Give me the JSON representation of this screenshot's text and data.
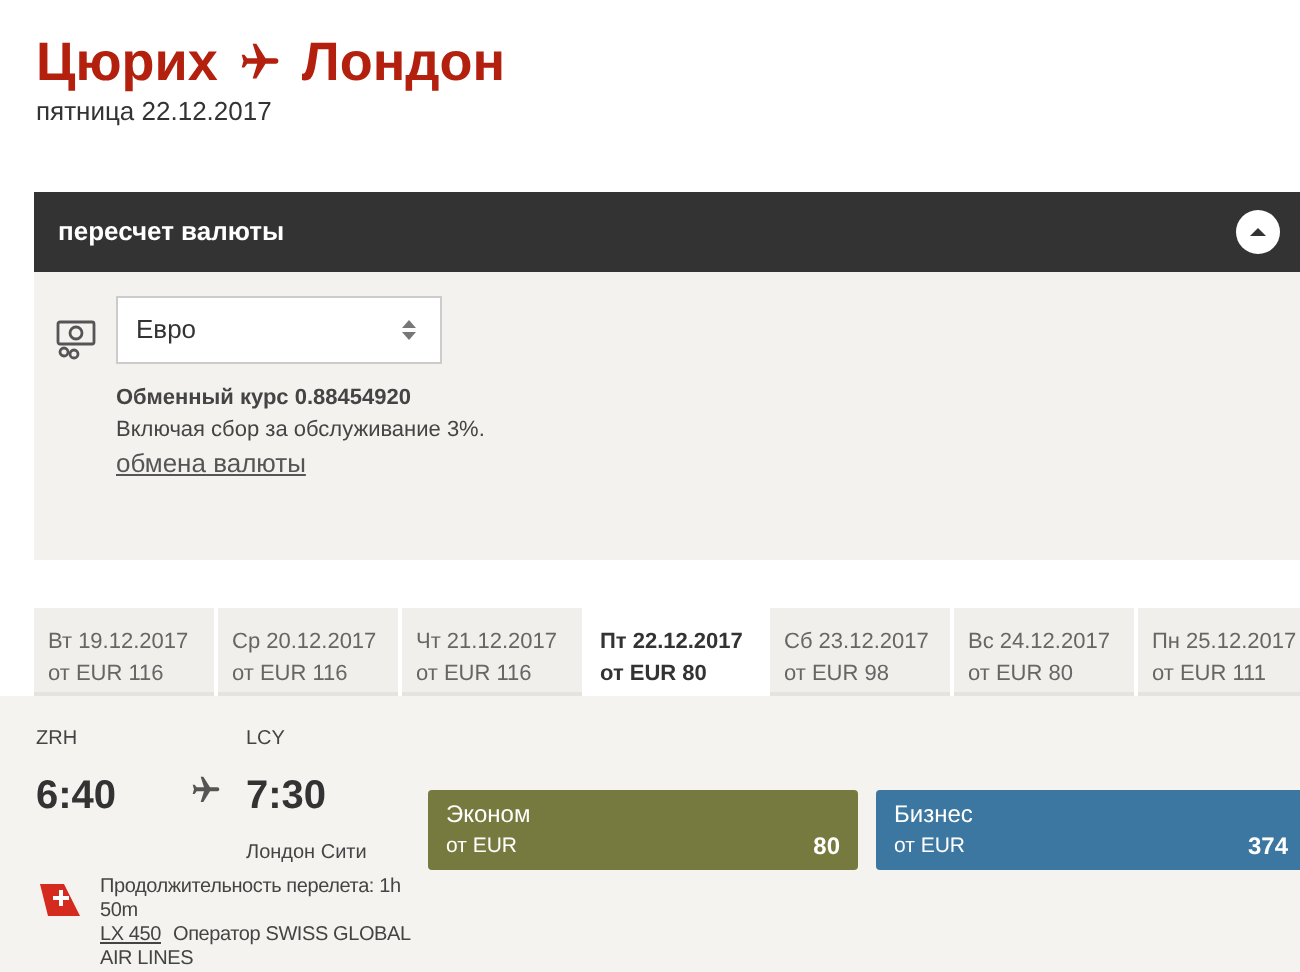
{
  "header": {
    "from": "Цюрих",
    "to": "Лондон",
    "date": "пятница 22.12.2017"
  },
  "currency_panel": {
    "title": "пересчет валюты",
    "expanded": true,
    "select_value": "Евро",
    "rate": "Обменный курс 0.88454920",
    "fee_note": "Включая сбор за обслуживание 3%.",
    "link": "обмена валюты"
  },
  "date_tabs": [
    {
      "date": "Вт 19.12.2017",
      "price": "от EUR 116",
      "selected": false
    },
    {
      "date": "Ср 20.12.2017",
      "price": "от EUR 116",
      "selected": false
    },
    {
      "date": "Чт 21.12.2017",
      "price": "от EUR 116",
      "selected": false
    },
    {
      "date": "Пт 22.12.2017",
      "price": "от EUR 80",
      "selected": true
    },
    {
      "date": "Сб 23.12.2017",
      "price": "от EUR 98",
      "selected": false
    },
    {
      "date": "Вс 24.12.2017",
      "price": "от EUR 80",
      "selected": false
    },
    {
      "date": "Пн 25.12.2017",
      "price": "от EUR 111",
      "selected": false
    }
  ],
  "flight": {
    "dep_code": "ZRH",
    "dep_time": "6:40",
    "arr_code": "LCY",
    "arr_time": "7:30",
    "arr_city": "Лондон Сити",
    "duration": "Продолжительность перелета: 1h 50m",
    "flight_no": "LX 450",
    "operator": "Оператор SWISS GLOBAL AIR LINES",
    "fares": [
      {
        "name": "Эконом",
        "from": "от EUR",
        "price": "80",
        "color": "#767a3e"
      },
      {
        "name": "Бизнес",
        "from": "от EUR",
        "price": "374",
        "color": "#3b77a1"
      }
    ]
  }
}
